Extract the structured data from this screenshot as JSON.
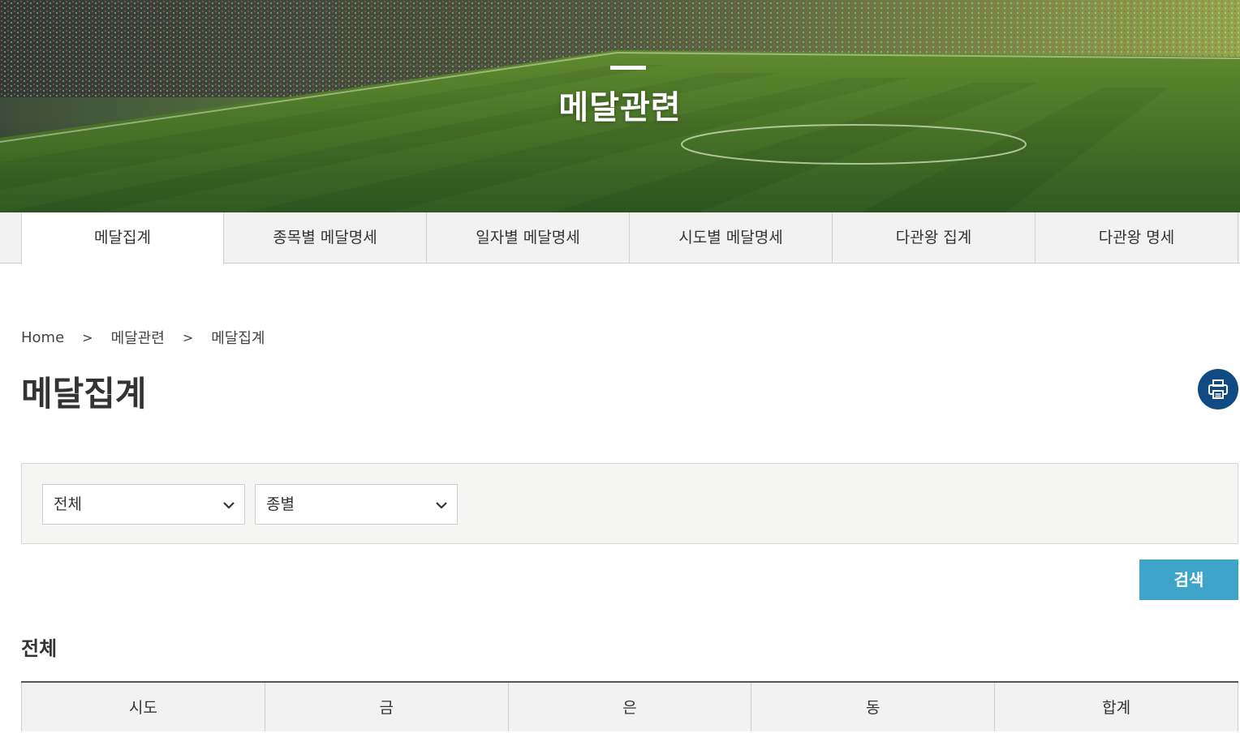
{
  "banner": {
    "title": "메달관련"
  },
  "tabs": [
    {
      "label": "메달집계",
      "active": true
    },
    {
      "label": "종목별 메달명세",
      "active": false
    },
    {
      "label": "일자별 메달명세",
      "active": false
    },
    {
      "label": "시도별 메달명세",
      "active": false
    },
    {
      "label": "다관왕 집계",
      "active": false
    },
    {
      "label": "다관왕 명세",
      "active": false
    }
  ],
  "breadcrumb": {
    "home": "Home",
    "section": "메달관련",
    "current": "메달집계",
    "separator": ">"
  },
  "page": {
    "title": "메달집계",
    "print_icon": "printer-icon"
  },
  "filters": {
    "region_select": {
      "value": "전체"
    },
    "type_select": {
      "value": "종별"
    },
    "search_label": "검색"
  },
  "result": {
    "section_title": "전체",
    "columns": [
      "시도",
      "금",
      "은",
      "동",
      "합계"
    ]
  },
  "colors": {
    "tab_bg": "#f2f2f2",
    "print_button": "#0f4a82",
    "search_button": "#3ea4c9"
  }
}
